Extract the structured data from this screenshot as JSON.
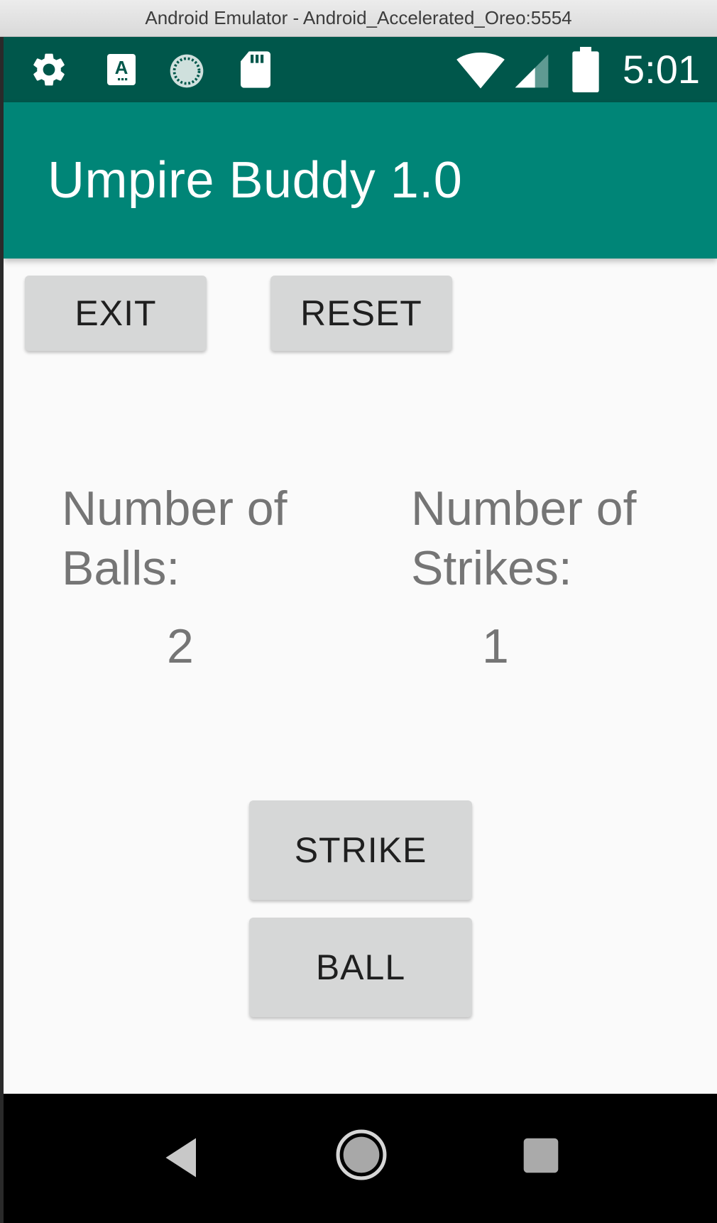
{
  "window": {
    "title": "Android Emulator - Android_Accelerated_Oreo:5554"
  },
  "status_bar": {
    "time": "5:01",
    "left_icons": [
      "gear-icon",
      "a-keyboard-notification-icon",
      "sync-progress-icon",
      "sd-card-icon"
    ],
    "right_icons": [
      "wifi-icon",
      "cell-signal-icon",
      "battery-icon"
    ]
  },
  "app_bar": {
    "title": "Umpire Buddy 1.0"
  },
  "top_buttons": {
    "exit_label": "EXIT",
    "reset_label": "RESET"
  },
  "balls": {
    "label_line1": "Number of",
    "label_line2": "Balls:",
    "value": "2"
  },
  "strikes": {
    "label_line1": "Number of",
    "label_line2": "Strikes:",
    "value": "1"
  },
  "action_buttons": {
    "strike_label": "STRIKE",
    "ball_label": "BALL"
  },
  "nav_bar": {
    "icons": [
      "back-icon",
      "home-icon",
      "recents-icon"
    ]
  },
  "colors": {
    "status_bar": "#00574b",
    "app_bar": "#008577",
    "background": "#fafafa",
    "button": "#d6d7d7",
    "counter_text": "#757575"
  }
}
